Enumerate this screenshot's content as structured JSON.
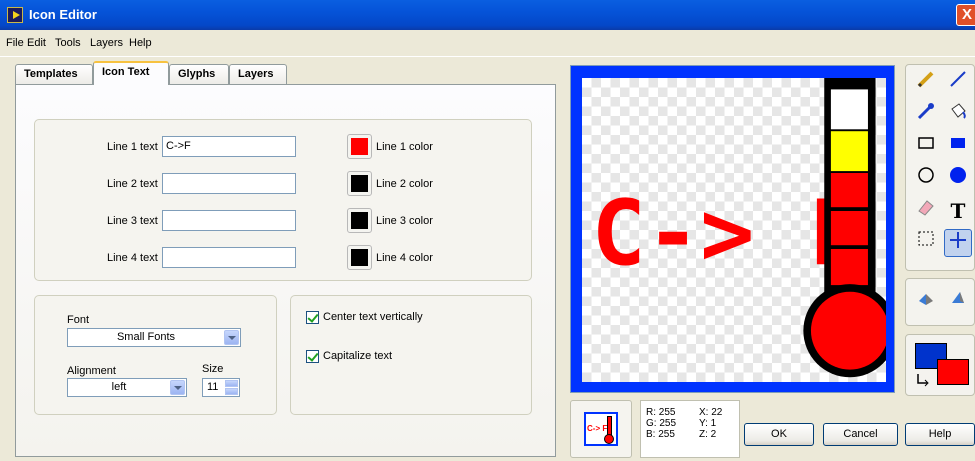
{
  "window": {
    "title": "Icon Editor",
    "close_glyph": "X"
  },
  "menu": [
    "File",
    "Edit",
    "Tools",
    "Layers",
    "Help"
  ],
  "tabs": [
    "Templates",
    "Icon Text",
    "Glyphs",
    "Layers"
  ],
  "active_tab": "Icon Text",
  "lines": [
    {
      "label": "Line 1 text",
      "value": "C->F",
      "color_label": "Line 1 color",
      "color": "#ff0000"
    },
    {
      "label": "Line 2 text",
      "value": "",
      "color_label": "Line 2 color",
      "color": "#000000"
    },
    {
      "label": "Line 3 text",
      "value": "",
      "color_label": "Line 3 color",
      "color": "#000000"
    },
    {
      "label": "Line 4 text",
      "value": "",
      "color_label": "Line 4 color",
      "color": "#000000"
    }
  ],
  "font": {
    "label": "Font",
    "value": "Small Fonts"
  },
  "alignment": {
    "label": "Alignment",
    "value": "left"
  },
  "size": {
    "label": "Size",
    "value": "11"
  },
  "options": {
    "center_vertically": {
      "label": "Center text vertically",
      "checked": true
    },
    "capitalize": {
      "label": "Capitalize text",
      "checked": true
    }
  },
  "canvas": {
    "text": "C-> F",
    "text_color": "#ff0000",
    "frame_color": "#0033ff"
  },
  "pixel_info": {
    "r": "R: 255",
    "g": "G: 255",
    "b": "B: 255",
    "x": "X: 22",
    "y": "Y: 1",
    "z": "Z: 2"
  },
  "preview_text": "C-> F",
  "colors": {
    "primary": "#0033cc",
    "secondary": "#ff0000"
  },
  "buttons": {
    "ok": "OK",
    "cancel": "Cancel",
    "help": "Help"
  },
  "tool_icons": [
    "pencil-icon",
    "line-icon",
    "dropper-icon",
    "fill-bucket-icon",
    "rectangle-icon",
    "filled-rectangle-icon",
    "ellipse-icon",
    "filled-ellipse-icon",
    "eraser-icon",
    "text-icon",
    "select-icon",
    "move-icon",
    "flip-horizontal-icon",
    "flip-vertical-icon",
    "swap-colors-icon"
  ],
  "text_tool_glyph": "T"
}
